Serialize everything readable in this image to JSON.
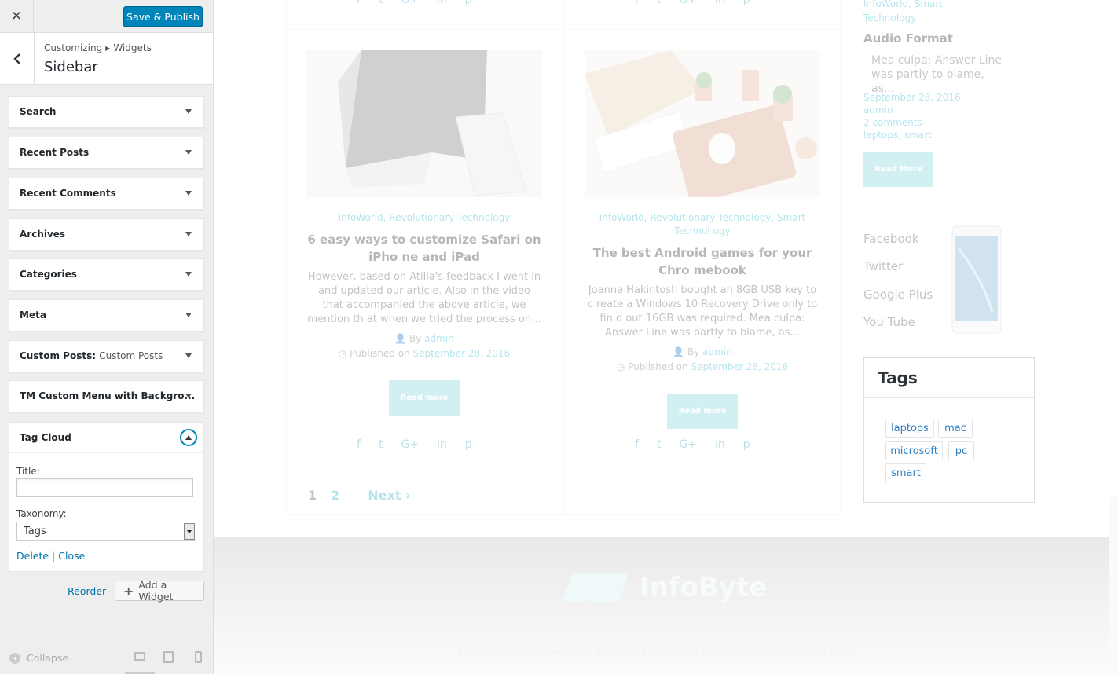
{
  "topbar": {
    "close_label": "✕",
    "save_label": "Save & Publish"
  },
  "section": {
    "breadcrumb_root": "Customizing",
    "breadcrumb_child": "Widgets",
    "title": "Sidebar"
  },
  "widgets": [
    {
      "title": "Search",
      "sub": ""
    },
    {
      "title": "Recent Posts",
      "sub": ""
    },
    {
      "title": "Recent Comments",
      "sub": ""
    },
    {
      "title": "Archives",
      "sub": ""
    },
    {
      "title": "Categories",
      "sub": ""
    },
    {
      "title": "Meta",
      "sub": ""
    },
    {
      "title": "Custom Posts:",
      "sub": "Custom Posts"
    },
    {
      "title": "TM Custom Menu with Backgro...",
      "sub": ""
    }
  ],
  "tag_cloud": {
    "title": "Tag Cloud",
    "title_label": "Title:",
    "title_value": "",
    "taxonomy_label": "Taxonomy:",
    "taxonomy_value": "Tags",
    "delete_label": "Delete",
    "separator": "|",
    "close_label": "Close"
  },
  "widget_actions": {
    "reorder": "Reorder",
    "add_widget": "Add a Widget"
  },
  "footer": {
    "collapse": "Collapse"
  },
  "preview": {
    "posts": [
      {
        "cats": "InfoWorld, Revolutionary Technology",
        "title": "6 easy ways to customize Safari on iPho ne and iPad",
        "excerpt": "However, based on Atilla's feedback I went in and updated our article. Also in the video that accompanied the above article, we mention th at when we tried the process on...",
        "by_label": "By",
        "author": "admin",
        "published_label": "Published on",
        "date": "September 28, 2016",
        "read_more": "Read more"
      },
      {
        "cats": "InfoWorld, Revolutionary Technology, Smart Technol ogy",
        "title": "The best Android games for your Chro mebook",
        "excerpt": "Joanne Hakintosh bought an 8GB USB key to c reate a Windows 10 Recovery Drive only to fin d out 16GB was required. Mea culpa: Answer Line was partly to blame, as...",
        "by_label": "By",
        "author": "admin",
        "published_label": "Published on",
        "date": "September 28, 2016",
        "read_more": "Read more"
      }
    ],
    "pager": {
      "page1": "1",
      "page2": "2",
      "next": "Next ›"
    },
    "right_post": {
      "cats_top": "InfoWorld, Smart",
      "cats_top2": "Technology",
      "title": "Audio Format",
      "excerpt": "Mea culpa: Answer Line was partly to blame, as...",
      "date": "September 28, 2016",
      "author": "admin",
      "comments": "2 comments",
      "tags": "laptops, smart",
      "read_more": "Read More"
    },
    "social": [
      "Facebook",
      "Twitter",
      "Google Plus",
      "You Tube"
    ],
    "tags_widget": {
      "title": "Tags",
      "tags": [
        "laptops",
        "mac",
        "microsoft",
        "pc",
        "smart"
      ]
    },
    "site_name": "InfoByte",
    "credits": "InfoByte is proudly powered by WordPress Entries (RSS) and Comments (RSS) Privacy Policy"
  }
}
